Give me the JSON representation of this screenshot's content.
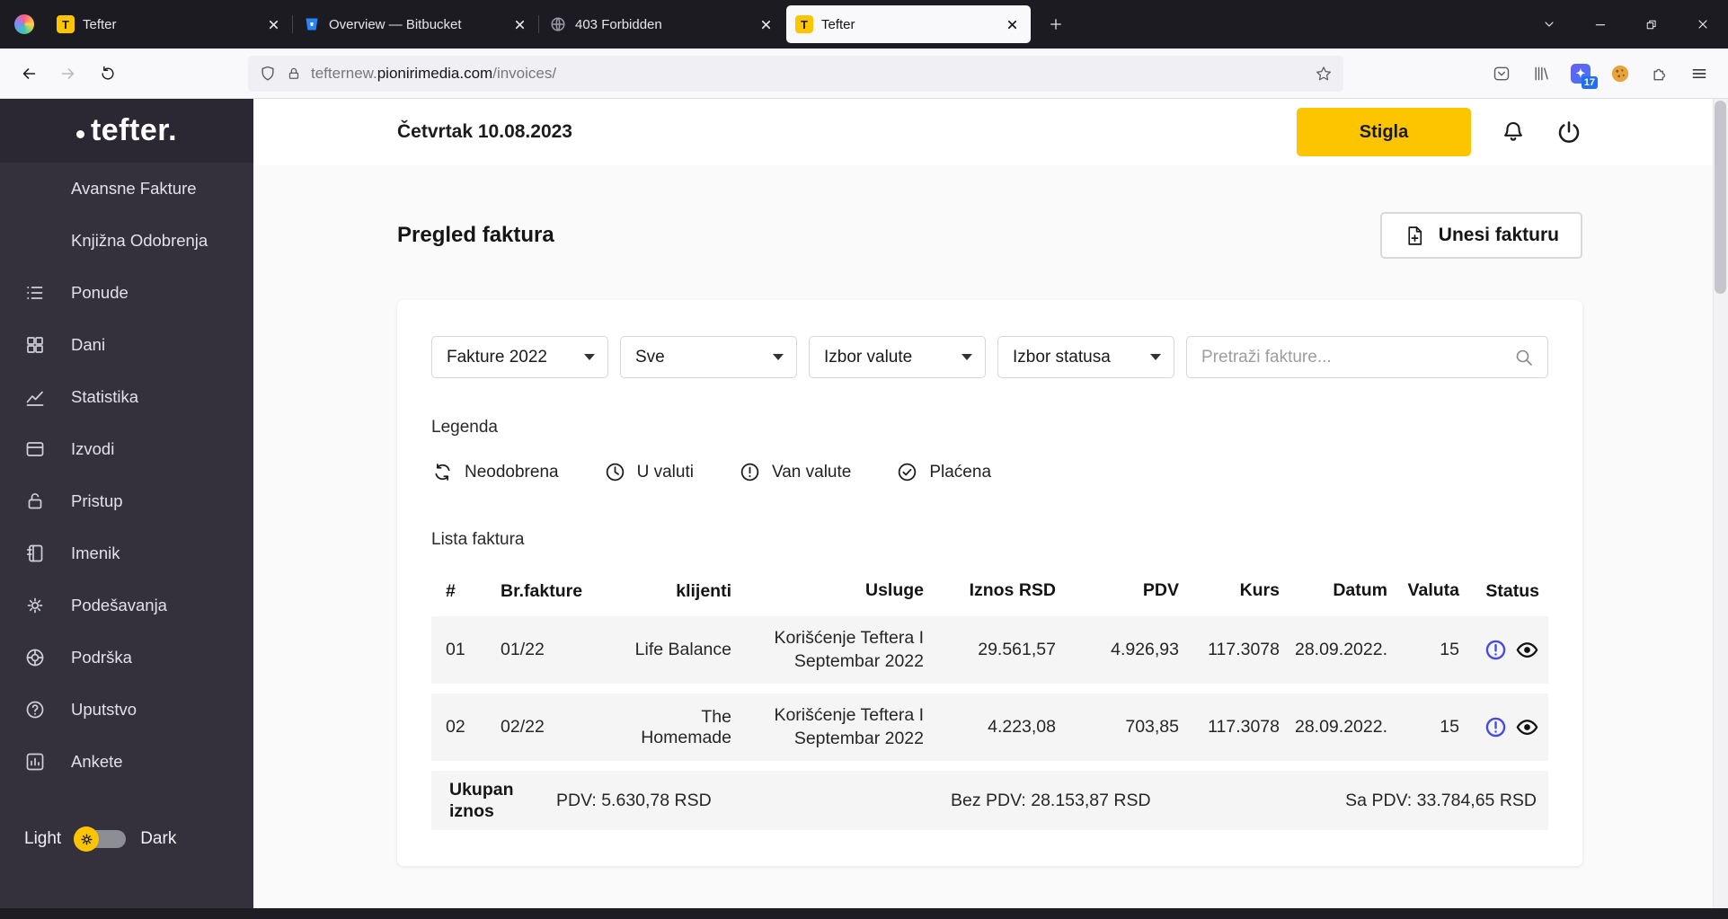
{
  "colors": {
    "accent": "#fdc500",
    "status_blue": "#474ae0",
    "sidebar_bg": "#35313c",
    "chrome_bg": "#1c1b22"
  },
  "browser": {
    "favicon_letter": "T",
    "tabs": [
      {
        "label": "Tefter",
        "icon": "tefter-favicon"
      },
      {
        "label": "Overview — Bitbucket",
        "icon": "bitbucket-favicon"
      },
      {
        "label": "403 Forbidden",
        "icon": "globe-favicon"
      },
      {
        "label": "Tefter",
        "icon": "tefter-favicon",
        "active": true
      }
    ],
    "url": {
      "subdomain": "tefternew.",
      "domain": "pionirimedia.com",
      "path": "/invoices/"
    },
    "extension_badge": "17"
  },
  "sidebar": {
    "logo": "tefter.",
    "items": [
      {
        "label": "Avansne Fakture",
        "icon": null
      },
      {
        "label": "Knjižna Odobrenja",
        "icon": null
      },
      {
        "label": "Ponude",
        "icon": "list-icon"
      },
      {
        "label": "Dani",
        "icon": "grid-icon"
      },
      {
        "label": "Statistika",
        "icon": "chart-icon"
      },
      {
        "label": "Izvodi",
        "icon": "card-icon"
      },
      {
        "label": "Pristup",
        "icon": "lock-icon"
      },
      {
        "label": "Imenik",
        "icon": "address-book-icon"
      },
      {
        "label": "Podešavanja",
        "icon": "gear-icon"
      },
      {
        "label": "Podrška",
        "icon": "support-icon"
      },
      {
        "label": "Uputstvo",
        "icon": "help-icon"
      },
      {
        "label": "Ankete",
        "icon": "poll-icon"
      }
    ],
    "theme": {
      "light": "Light",
      "dark": "Dark"
    }
  },
  "header": {
    "date": "Četvrtak 10.08.2023",
    "status_button": "Stigla"
  },
  "main": {
    "title": "Pregled faktura",
    "add_button": "Unesi fakturu",
    "filters": {
      "year": "Fakture 2022",
      "client": "Sve",
      "currency": "Izbor valute",
      "status": "Izbor statusa",
      "search_placeholder": "Pretraži fakture..."
    },
    "legend": {
      "title": "Legenda",
      "items": [
        {
          "label": "Neodobrena",
          "icon": "refresh-icon"
        },
        {
          "label": "U valuti",
          "icon": "clock-icon"
        },
        {
          "label": "Van valute",
          "icon": "exclamation-icon"
        },
        {
          "label": "Plaćena",
          "icon": "check-icon"
        }
      ]
    },
    "table": {
      "title": "Lista faktura",
      "headers": [
        "#",
        "Br.fakture",
        "klijenti",
        "Usluge",
        "Iznos RSD",
        "PDV",
        "Kurs",
        "Datum",
        "Valuta",
        "Status"
      ],
      "rows": [
        {
          "num": "01",
          "br": "01/22",
          "klijent": "Life Balance",
          "usluga": "Korišćenje Teftera I Septembar 2022",
          "iznos": "29.561,57",
          "pdv": "4.926,93",
          "kurs": "117.3078",
          "datum": "28.09.2022.",
          "valuta": "15",
          "status_icons": [
            "exclamation-circle-icon",
            "eye-icon"
          ]
        },
        {
          "num": "02",
          "br": "02/22",
          "klijent": "The Homemade",
          "usluga": "Korišćenje Teftera I Septembar 2022",
          "iznos": "4.223,08",
          "pdv": "703,85",
          "kurs": "117.3078",
          "datum": "28.09.2022.",
          "valuta": "15",
          "status_icons": [
            "exclamation-circle-icon",
            "eye-icon"
          ]
        }
      ],
      "footer": {
        "label": "Ukupan iznos",
        "pdv": "PDV: 5.630,78 RSD",
        "bez": "Bez PDV: 28.153,87 RSD",
        "sa": "Sa PDV: 33.784,65 RSD"
      }
    }
  }
}
